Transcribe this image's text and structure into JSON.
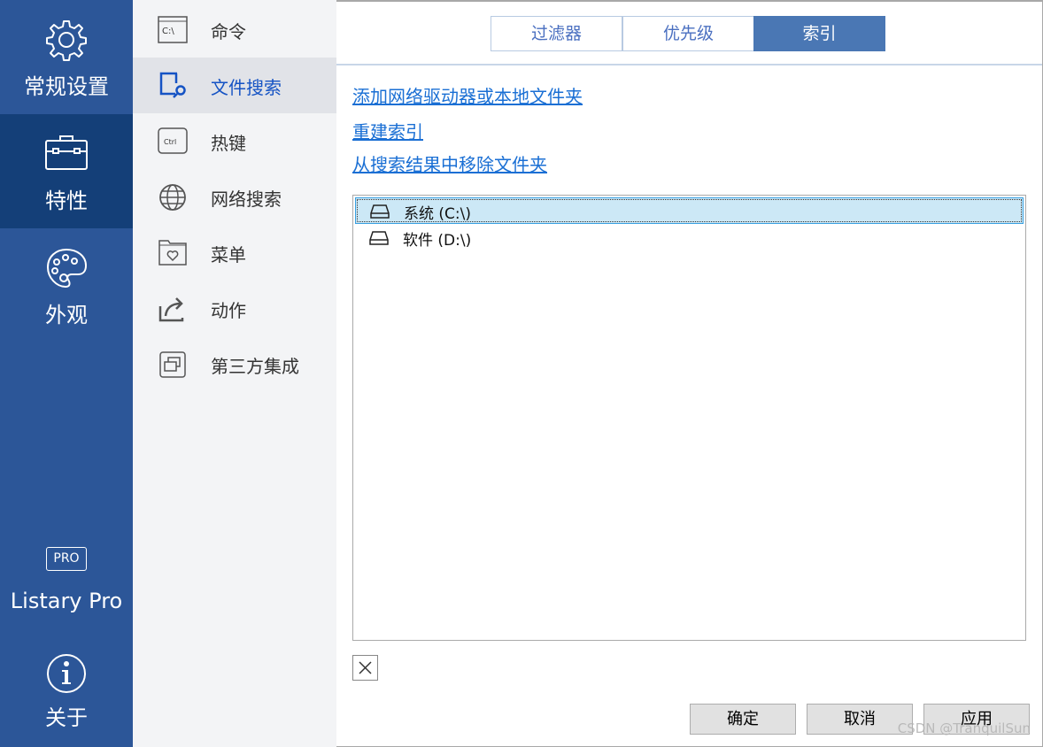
{
  "nav": {
    "items": [
      {
        "label": "常规设置",
        "icon": "gear-icon"
      },
      {
        "label": "特性",
        "icon": "toolbox-icon",
        "active": true
      },
      {
        "label": "外观",
        "icon": "palette-icon"
      },
      {
        "label": "Listary Pro",
        "icon": "pro-badge-icon",
        "badge": "PRO"
      },
      {
        "label": "关于",
        "icon": "info-icon"
      }
    ]
  },
  "sub": {
    "items": [
      {
        "label": "命令",
        "icon": "command-prompt-icon",
        "icon_text": "C:\\"
      },
      {
        "label": "文件搜索",
        "icon": "file-search-icon",
        "active": true
      },
      {
        "label": "热键",
        "icon": "ctrl-key-icon",
        "icon_text": "Ctrl"
      },
      {
        "label": "网络搜索",
        "icon": "globe-icon"
      },
      {
        "label": "菜单",
        "icon": "folder-heart-icon"
      },
      {
        "label": "动作",
        "icon": "share-arrow-icon"
      },
      {
        "label": "第三方集成",
        "icon": "windows-stack-icon"
      }
    ]
  },
  "tabs": [
    {
      "label": "过滤器"
    },
    {
      "label": "优先级"
    },
    {
      "label": "索引",
      "active": true
    }
  ],
  "links": [
    "添加网络驱动器或本地文件夹",
    "重建索引",
    "从搜索结果中移除文件夹"
  ],
  "list": [
    {
      "label": "系统 (C:\\)",
      "selected": true
    },
    {
      "label": "软件 (D:\\)"
    }
  ],
  "buttons": {
    "ok": "确定",
    "cancel": "取消",
    "apply": "应用"
  },
  "watermark": "CSDN @TranquilSun",
  "colors": {
    "nav": "#2c5698",
    "nav_active": "#143f78",
    "accent": "#4a77b4",
    "link": "#1a6fd4",
    "selection": "#cce8f6"
  }
}
